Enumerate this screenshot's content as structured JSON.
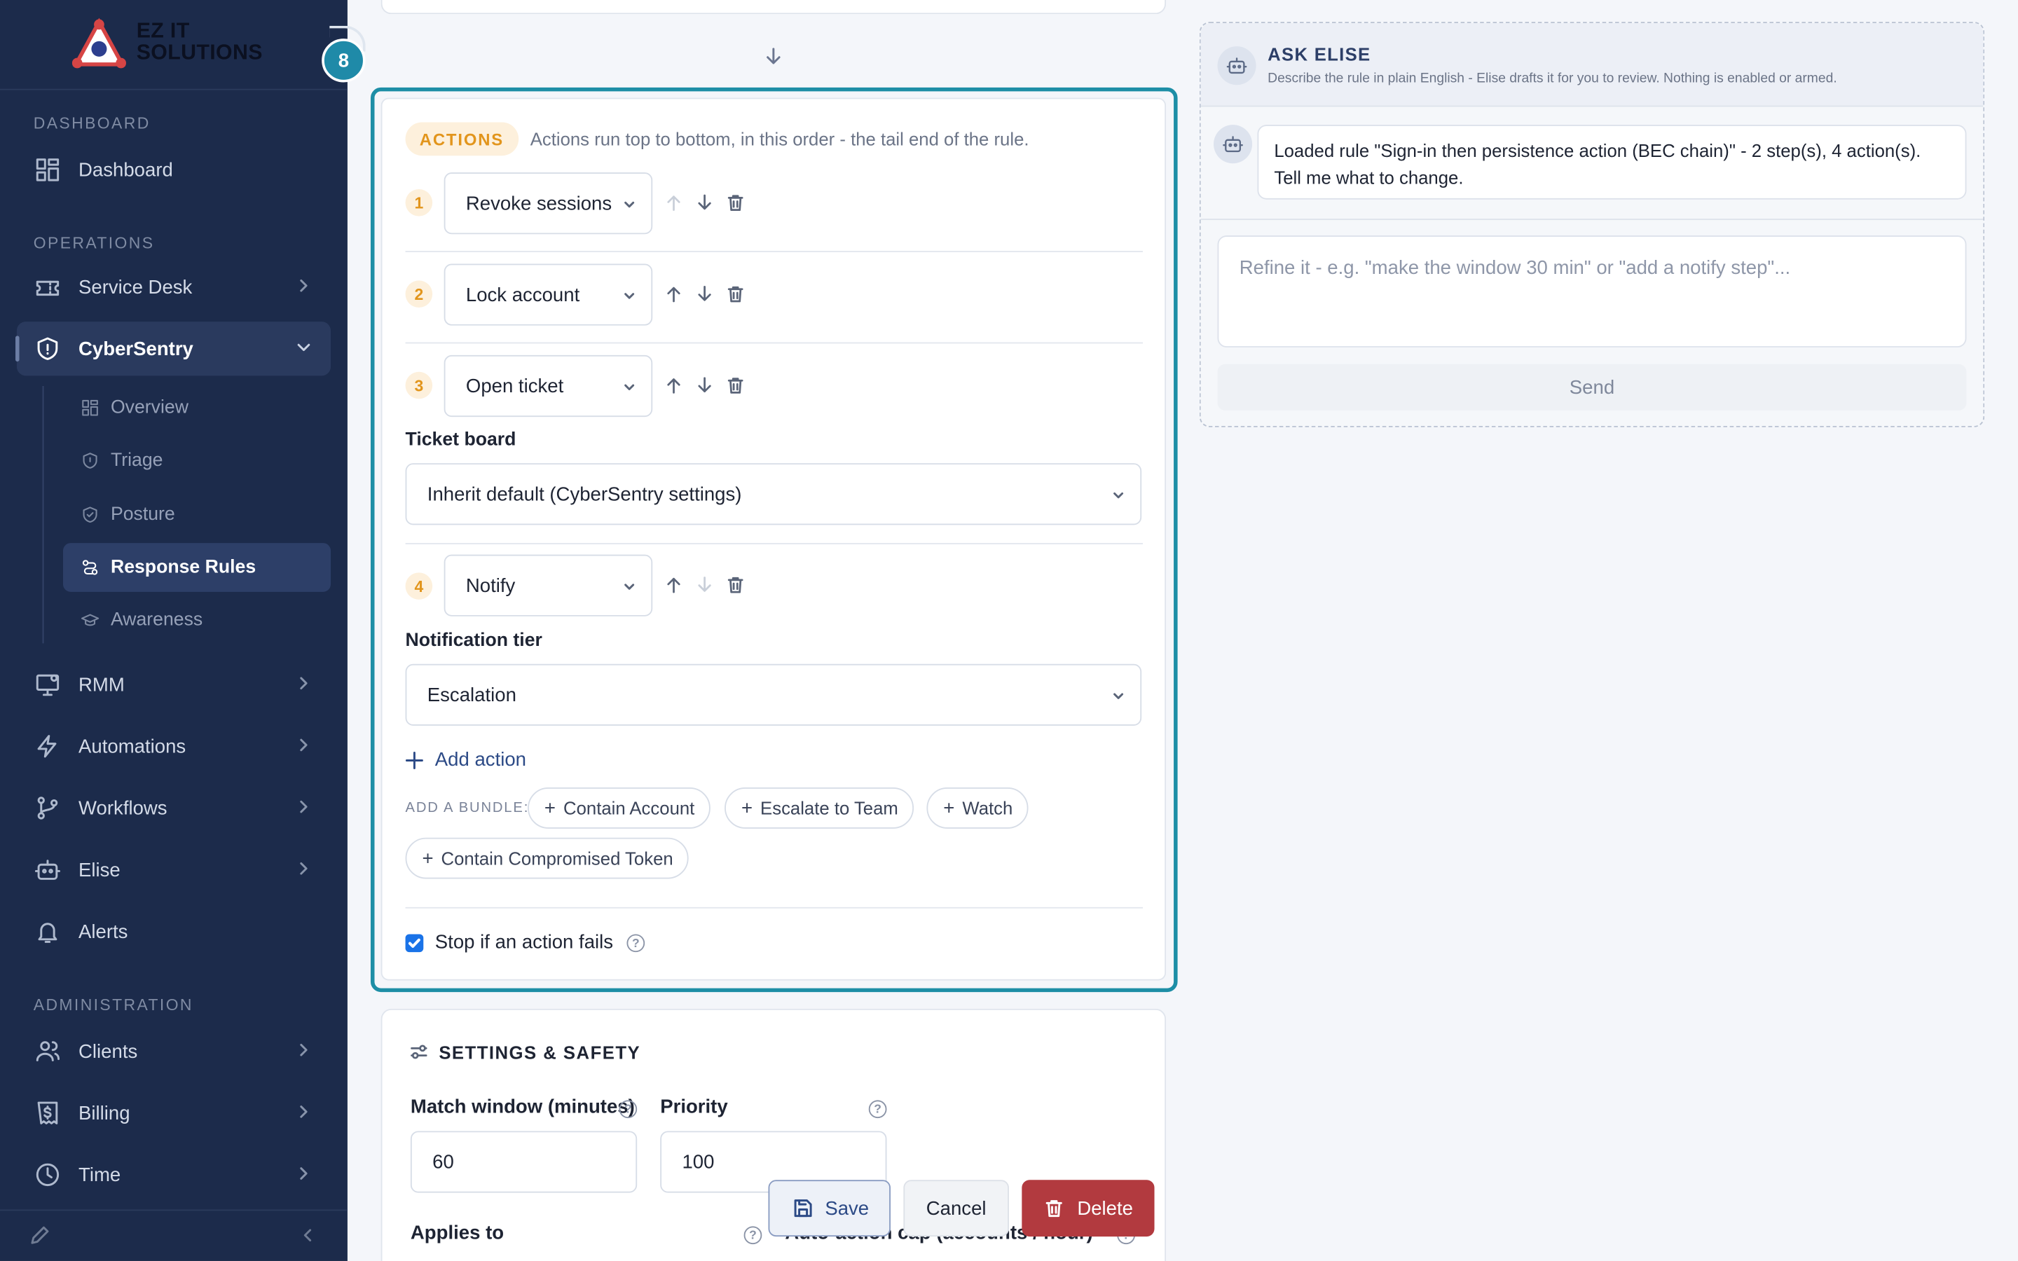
{
  "brand": {
    "line1": "EZ IT",
    "line2": "SOLUTIONS",
    "badge": "8"
  },
  "sidebar": {
    "sections": {
      "dashboard": "DASHBOARD",
      "operations": "OPERATIONS",
      "administration": "ADMINISTRATION"
    },
    "items": {
      "dashboard": "Dashboard",
      "service_desk": "Service Desk",
      "cybersentry": "CyberSentry",
      "rmm": "RMM",
      "automations": "Automations",
      "workflows": "Workflows",
      "elise": "Elise",
      "alerts": "Alerts",
      "clients": "Clients",
      "billing": "Billing",
      "time": "Time"
    },
    "sub_items": {
      "overview": "Overview",
      "triage": "Triage",
      "posture": "Posture",
      "response_rules": "Response Rules",
      "awareness": "Awareness"
    }
  },
  "actions": {
    "pill": "ACTIONS",
    "description": "Actions run top to bottom, in this order - the tail end of the rule.",
    "rows": [
      {
        "num": "1",
        "value": "Revoke sessions"
      },
      {
        "num": "2",
        "value": "Lock account"
      },
      {
        "num": "3",
        "value": "Open ticket"
      },
      {
        "num": "4",
        "value": "Notify"
      }
    ],
    "ticket_board_label": "Ticket board",
    "ticket_board_value": "Inherit default (CyberSentry settings)",
    "notification_tier_label": "Notification tier",
    "notification_tier_value": "Escalation",
    "add_action": "Add action",
    "bundle_label": "ADD A BUNDLE:",
    "bundles": [
      "Contain Account",
      "Escalate to Team",
      "Watch",
      "Contain Compromised Token"
    ],
    "stop_on_fail": "Stop if an action fails",
    "stop_on_fail_checked": true
  },
  "settings": {
    "title": "SETTINGS & SAFETY",
    "match_window_label": "Match window (minutes)",
    "match_window_value": "60",
    "priority_label": "Priority",
    "priority_value": "100",
    "applies_to_label": "Applies to",
    "auto_action_cap_label": "Auto-action cap (accounts / hour)"
  },
  "buttons": {
    "save": "Save",
    "cancel": "Cancel",
    "delete": "Delete"
  },
  "elise": {
    "title": "ASK ELISE",
    "subtitle": "Describe the rule in plain English - Elise drafts it for you to review. Nothing is enabled or armed.",
    "message_line1": "Loaded rule \"Sign-in then persistence action (BEC chain)\" - 2 step(s), 4 action(s).",
    "message_line2": "Tell me what to change.",
    "input_placeholder": "Refine it - e.g. \"make the window 30 min\" or \"add a notify step\"...",
    "send": "Send"
  },
  "colors": {
    "sidebar_bg": "#1c2b4b",
    "accent_teal": "#1d8ea6",
    "action_orange": "#e2951c",
    "delete_red": "#b23a3f"
  }
}
